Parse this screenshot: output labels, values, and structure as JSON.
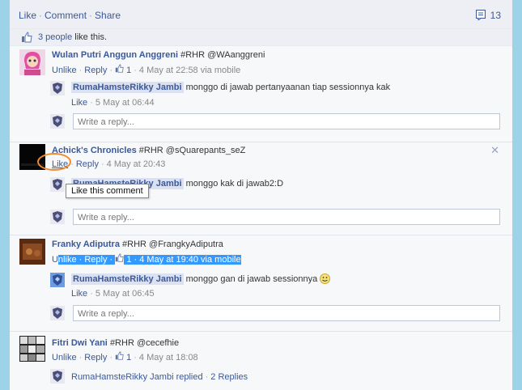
{
  "top_actions": {
    "like": "Like",
    "comment": "Comment",
    "share": "Share"
  },
  "comment_count": "13",
  "likes": {
    "count_text": "3 people",
    "suffix": " like this."
  },
  "posts": [
    {
      "author": "Wulan Putri Anggun Anggreni",
      "text": "#RHR @WAanggreni",
      "actions": {
        "unlike": "Unlike",
        "reply": "Reply",
        "likes": "1",
        "time": "4 May at 22:58 via mobile"
      },
      "reply": {
        "author": "RumaHamsteRikky Jambi",
        "text": "monggo di jawab pertanyaanan tiap sessionnya kak",
        "like": "Like",
        "time": "5 May at 06:44"
      },
      "placeholder": "Write a reply..."
    },
    {
      "author": "Achick's Chronicles",
      "text": "#RHR @sQuarepants_seZ",
      "actions": {
        "like": "Like",
        "reply": "Reply",
        "time": "4 May at 20:43"
      },
      "reply": {
        "author": "RumaHamsteRikky Jambi",
        "text": "monggo kak di jawab2:D"
      },
      "tooltip": "Like this comment",
      "placeholder": "Write a reply..."
    },
    {
      "author": "Franky Adiputra",
      "text": "#RHR @FrangkyAdiputra",
      "actions": {
        "unlike_u": "U",
        "unlike_rest": "nlike",
        "reply": "Reply",
        "likes": "1",
        "time": "4 May at 19:40 via mobile"
      },
      "reply": {
        "author": "RumaHamsteRikky Jambi",
        "text": "monggo gan di jawab sessionnya",
        "like": "Like",
        "time": "5 May at 06:45"
      },
      "placeholder": "Write a reply..."
    },
    {
      "author": "Fitri Dwi Yani",
      "text": "#RHR @cecefhie",
      "actions": {
        "unlike": "Unlike",
        "reply": "Reply",
        "likes": "1",
        "time": "4 May at 18:08"
      },
      "replied": {
        "author": "RumaHamsteRikky Jambi",
        "text": "replied",
        "count": "2 Replies"
      }
    }
  ],
  "colors": {
    "link": "#3b5998",
    "highlight": "#3399ff",
    "circle": "#f08a2c",
    "background": "#9dd3e9"
  }
}
